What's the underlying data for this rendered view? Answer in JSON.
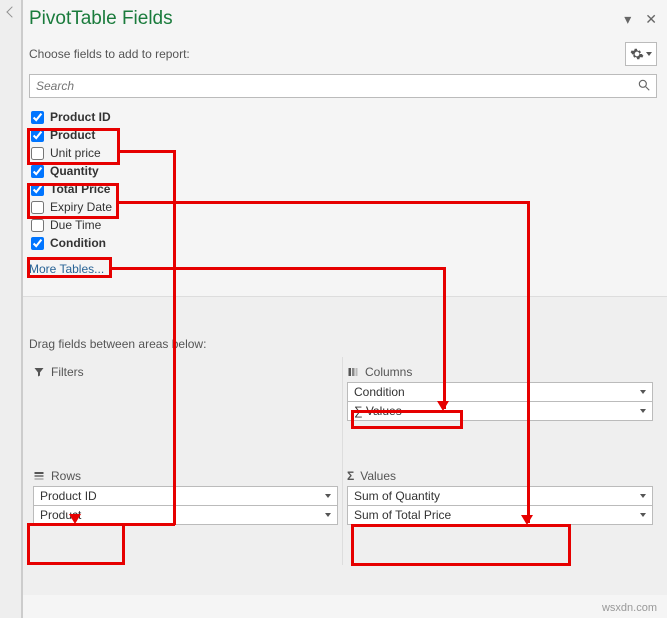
{
  "title": "PivotTable Fields",
  "subtitle": "Choose fields to add to report:",
  "search": {
    "placeholder": "Search"
  },
  "fields": [
    {
      "label": "Product ID",
      "checked": true
    },
    {
      "label": "Product",
      "checked": true
    },
    {
      "label": "Unit price",
      "checked": false
    },
    {
      "label": "Quantity",
      "checked": true
    },
    {
      "label": "Total Price",
      "checked": true
    },
    {
      "label": "Expiry Date",
      "checked": false
    },
    {
      "label": "Due Time",
      "checked": false
    },
    {
      "label": "Condition",
      "checked": true
    }
  ],
  "moreTables": "More Tables...",
  "dragLabel": "Drag fields between areas below:",
  "areas": {
    "filters": {
      "title": "Filters",
      "items": []
    },
    "columns": {
      "title": "Columns",
      "items": [
        "Condition",
        "∑ Values"
      ]
    },
    "rows": {
      "title": "Rows",
      "items": [
        "Product ID",
        "Product"
      ]
    },
    "values": {
      "title": "Values",
      "items": [
        "Sum of Quantity",
        "Sum of Total Price"
      ]
    }
  },
  "watermark": "wsxdn.com"
}
